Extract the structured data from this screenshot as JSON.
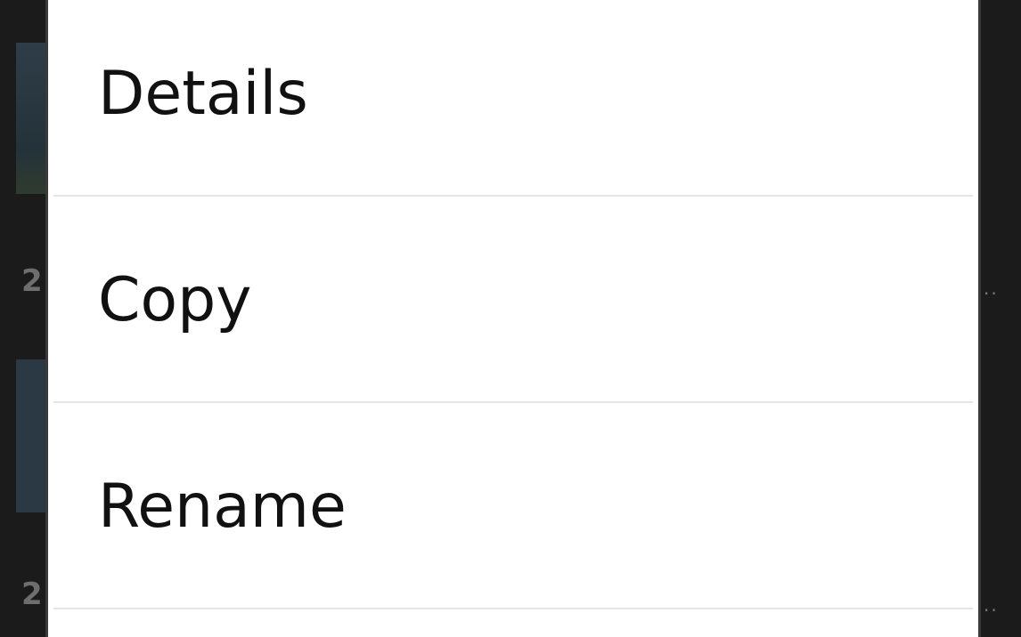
{
  "background": {
    "row_numbers": [
      "2",
      "2"
    ],
    "overflow_indicator": ".."
  },
  "dialog": {
    "menu_items": [
      {
        "label": "Details"
      },
      {
        "label": "Copy"
      },
      {
        "label": "Rename"
      }
    ]
  }
}
